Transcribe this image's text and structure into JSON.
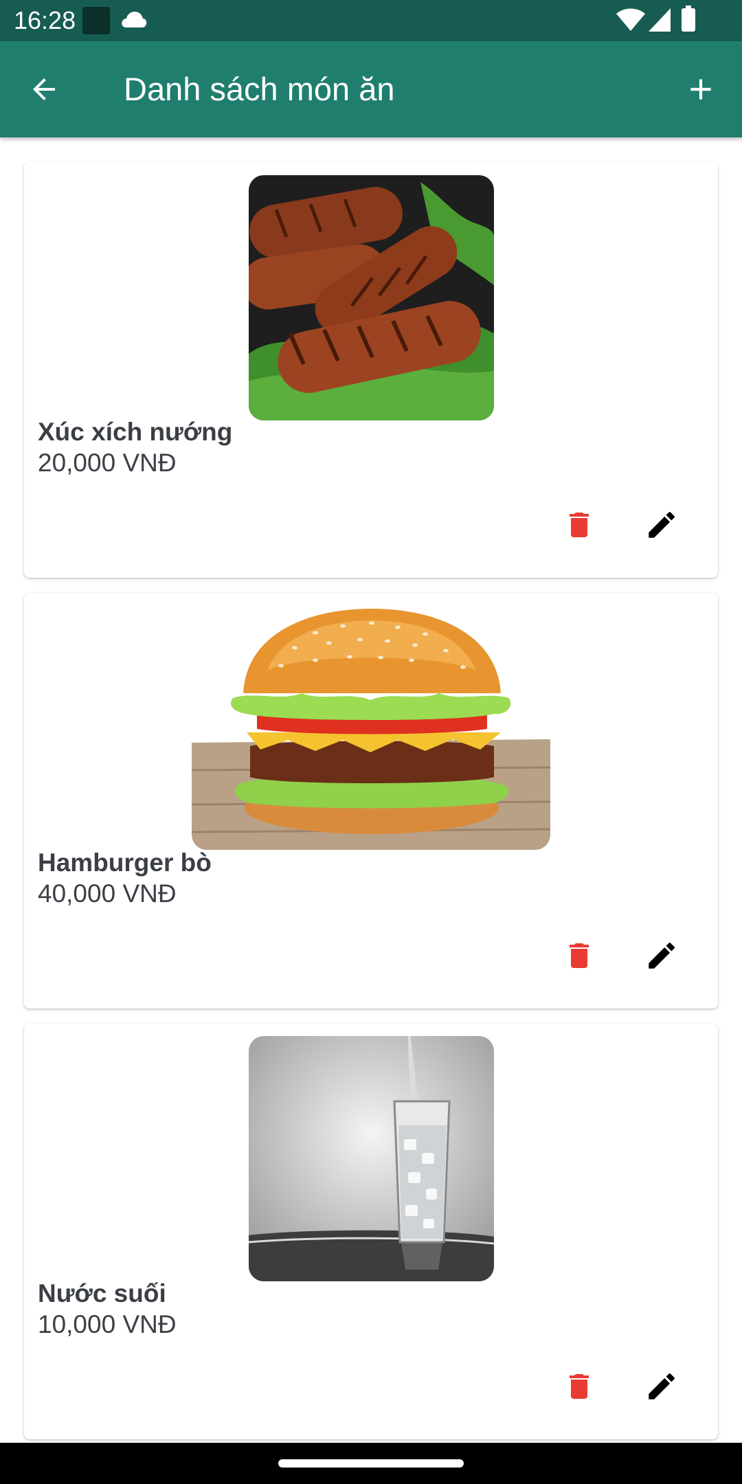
{
  "status_bar": {
    "time": "16:28"
  },
  "app_bar": {
    "title": "Danh sách món ăn"
  },
  "colors": {
    "accent": "#207e6e",
    "status_bar": "#175c52",
    "delete": "#ea3b33",
    "edit": "#000000"
  },
  "icons": {
    "back": "arrow-back-icon",
    "add": "plus-icon",
    "delete": "trash-icon",
    "edit": "pencil-icon"
  },
  "items": [
    {
      "name": "Xúc xích nướng",
      "price": "20,000 VNĐ",
      "image": "grilled-sausages"
    },
    {
      "name": "Hamburger bò",
      "price": "40,000 VNĐ",
      "image": "beef-hamburger"
    },
    {
      "name": "Nước suối",
      "price": "10,000 VNĐ",
      "image": "glass-of-water"
    }
  ]
}
